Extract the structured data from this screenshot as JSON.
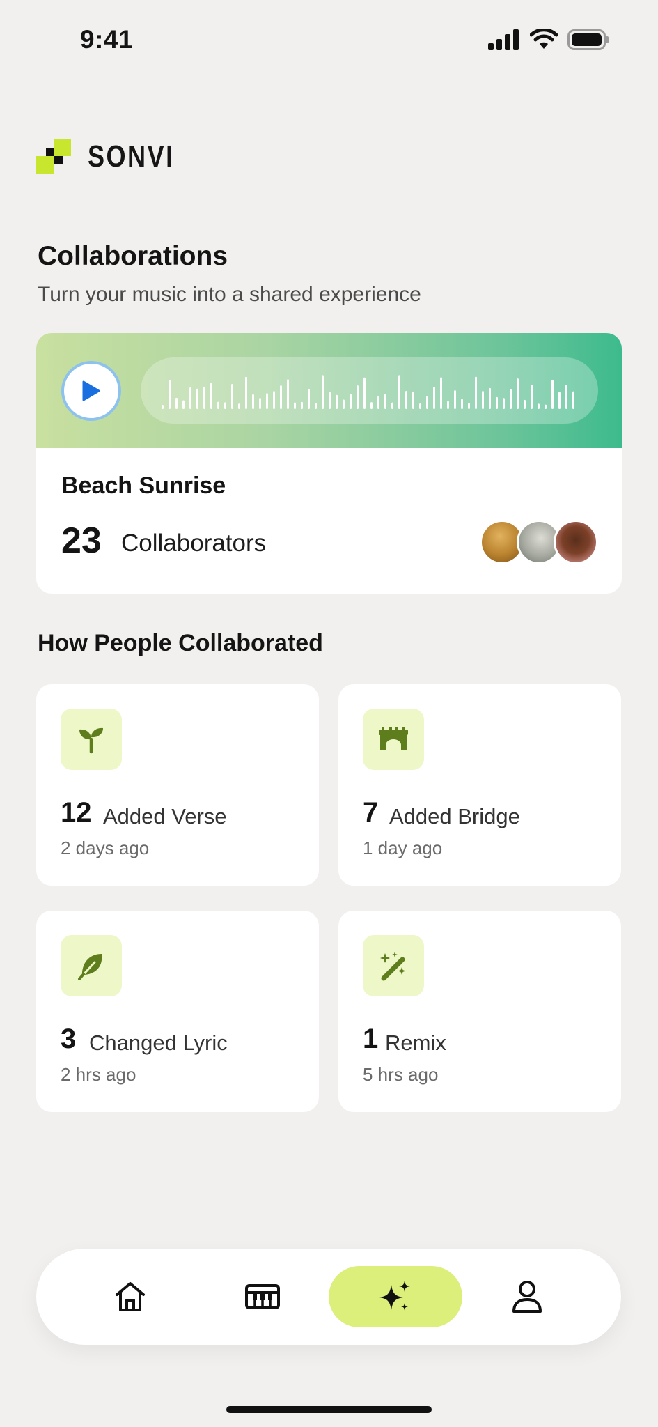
{
  "status": {
    "time": "9:41"
  },
  "brand": {
    "name": "SONVI"
  },
  "page": {
    "title": "Collaborations",
    "subtitle": "Turn your music into a shared experience"
  },
  "track": {
    "title": "Beach Sunrise",
    "collaborator_count": "23",
    "collaborator_label": "Collaborators",
    "play_icon": "play-icon",
    "colors": {
      "banner_start": "#c9e0a0",
      "banner_end": "#3dbb8d",
      "play_border": "#8ec2ee",
      "play_triangle": "#1a6fe0"
    }
  },
  "section": {
    "title": "How People Collaborated"
  },
  "activities": [
    {
      "count": "12",
      "label": "Added Verse",
      "time": "2 days ago",
      "icon": "sprout-icon"
    },
    {
      "count": "7",
      "label": "Added Bridge",
      "time": "1 day ago",
      "icon": "bridge-icon"
    },
    {
      "count": "3",
      "label": "Changed Lyric",
      "time": "2 hrs ago",
      "icon": "feather-icon"
    },
    {
      "count": "1",
      "label": "Remix",
      "time": "5 hrs ago",
      "icon": "magic-wand-icon"
    }
  ],
  "nav": {
    "items": [
      {
        "name": "home",
        "icon": "home-icon",
        "active": false
      },
      {
        "name": "piano",
        "icon": "piano-icon",
        "active": false
      },
      {
        "name": "sparkles",
        "icon": "sparkles-icon",
        "active": true
      },
      {
        "name": "profile",
        "icon": "user-icon",
        "active": false
      }
    ],
    "active_color": "#dbef7a"
  },
  "colors": {
    "background": "#f1f0ee",
    "accent_green": "#5e7d1c",
    "icon_tile": "#eef7c8",
    "logo_lime": "#c8e62e"
  }
}
